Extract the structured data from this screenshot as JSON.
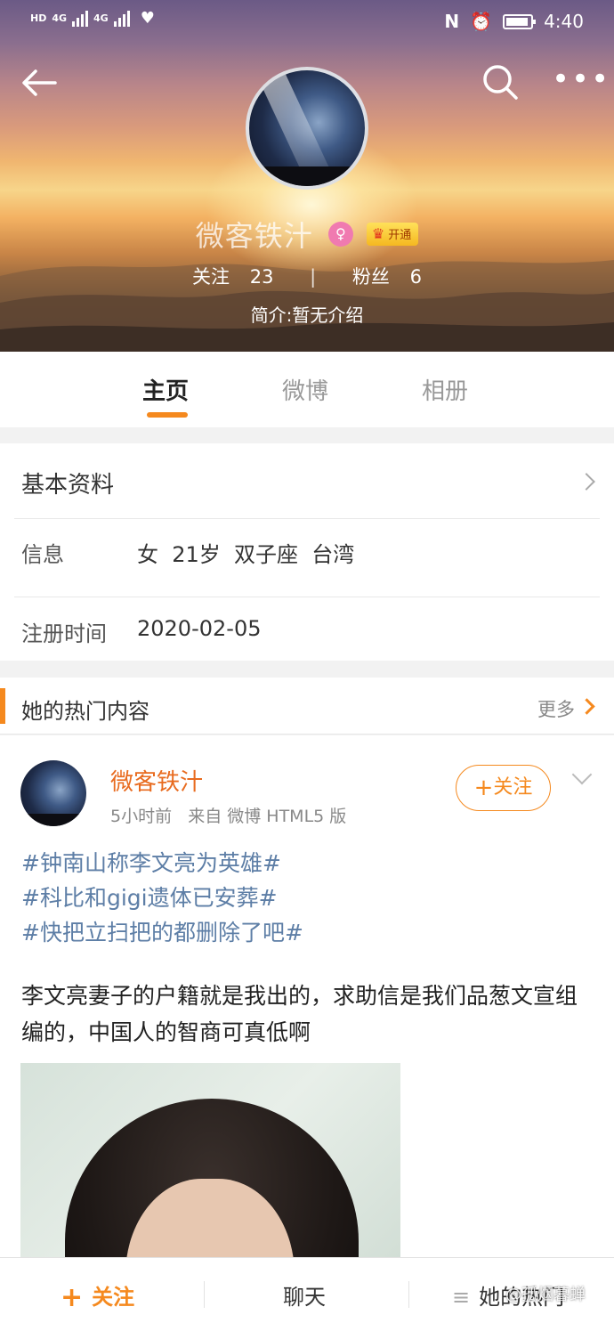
{
  "status_bar": {
    "left_labels": [
      "HD",
      "4G",
      "4G"
    ],
    "time": "4:40",
    "icons": [
      "nfc-icon",
      "alarm-icon",
      "battery-icon"
    ]
  },
  "profile": {
    "name": "微客铁汁",
    "vip_label": "开通",
    "following_label": "关注",
    "following_count": "23",
    "fans_label": "粉丝",
    "fans_count": "6",
    "intro": "简介:暂无介绍"
  },
  "tabs": [
    {
      "label": "主页",
      "active": true
    },
    {
      "label": "微博",
      "active": false
    },
    {
      "label": "相册",
      "active": false
    }
  ],
  "basic_info": {
    "title": "基本资料",
    "info_label": "信息",
    "info_value": "女  21岁  双子座  台湾",
    "register_label": "注册时间",
    "register_value": "2020-02-05"
  },
  "hot": {
    "title": "她的热门内容",
    "more": "更多"
  },
  "post": {
    "author": "微客铁汁",
    "meta": "5小时前   来自 微博 HTML5 版",
    "follow_label": "关注",
    "topics": [
      "#钟南山称李文亮为英雄#",
      "#科比和gigi遗体已安葬#",
      "#快把立扫把的都删除了吧#"
    ],
    "text": "李文亮妻子的户籍就是我出的，求助信是我们品葱文宣组编的，中国人的智商可真低啊"
  },
  "bottom_bar": {
    "follow": "关注",
    "chat": "聊天",
    "hot": "她的热门"
  },
  "watermark": "@孤烟暮蝉",
  "colors": {
    "accent": "#f5891e",
    "topic": "#5d7ea6",
    "author": "#e86b1f"
  }
}
